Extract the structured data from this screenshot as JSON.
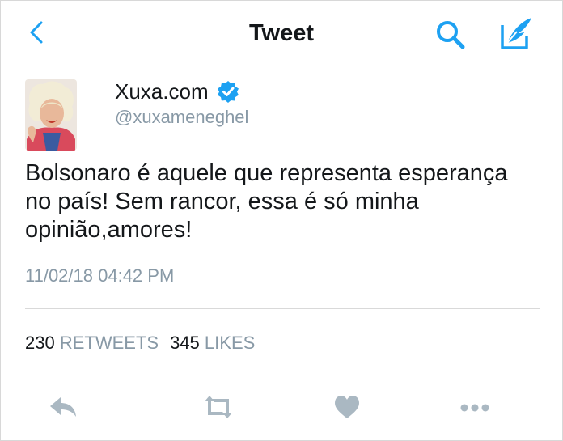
{
  "header": {
    "title": "Tweet",
    "back_icon": "chevron-left-icon",
    "search_icon": "search-icon",
    "compose_icon": "compose-tweet-icon"
  },
  "author": {
    "display_name": "Xuxa.com",
    "handle": "@xuxameneghel",
    "verified": true
  },
  "tweet": {
    "text": "Bolsonaro é aquele que representa esperança\nno país! Sem rancor, essa é só minha\nopinião,amores!",
    "timestamp": "11/02/18 04:42 PM"
  },
  "stats": {
    "retweets_count": "230",
    "retweets_label": "RETWEETS",
    "likes_count": "345",
    "likes_label": "LIKES"
  },
  "actions": [
    {
      "icon": "reply-icon"
    },
    {
      "icon": "retweet-icon"
    },
    {
      "icon": "like-heart-icon"
    },
    {
      "icon": "more-options-icon"
    }
  ],
  "colors": {
    "accent": "#1da1f2",
    "secondary_text": "#8899a6",
    "action_icon": "#aab8c2",
    "divider": "#d9d9d9"
  }
}
